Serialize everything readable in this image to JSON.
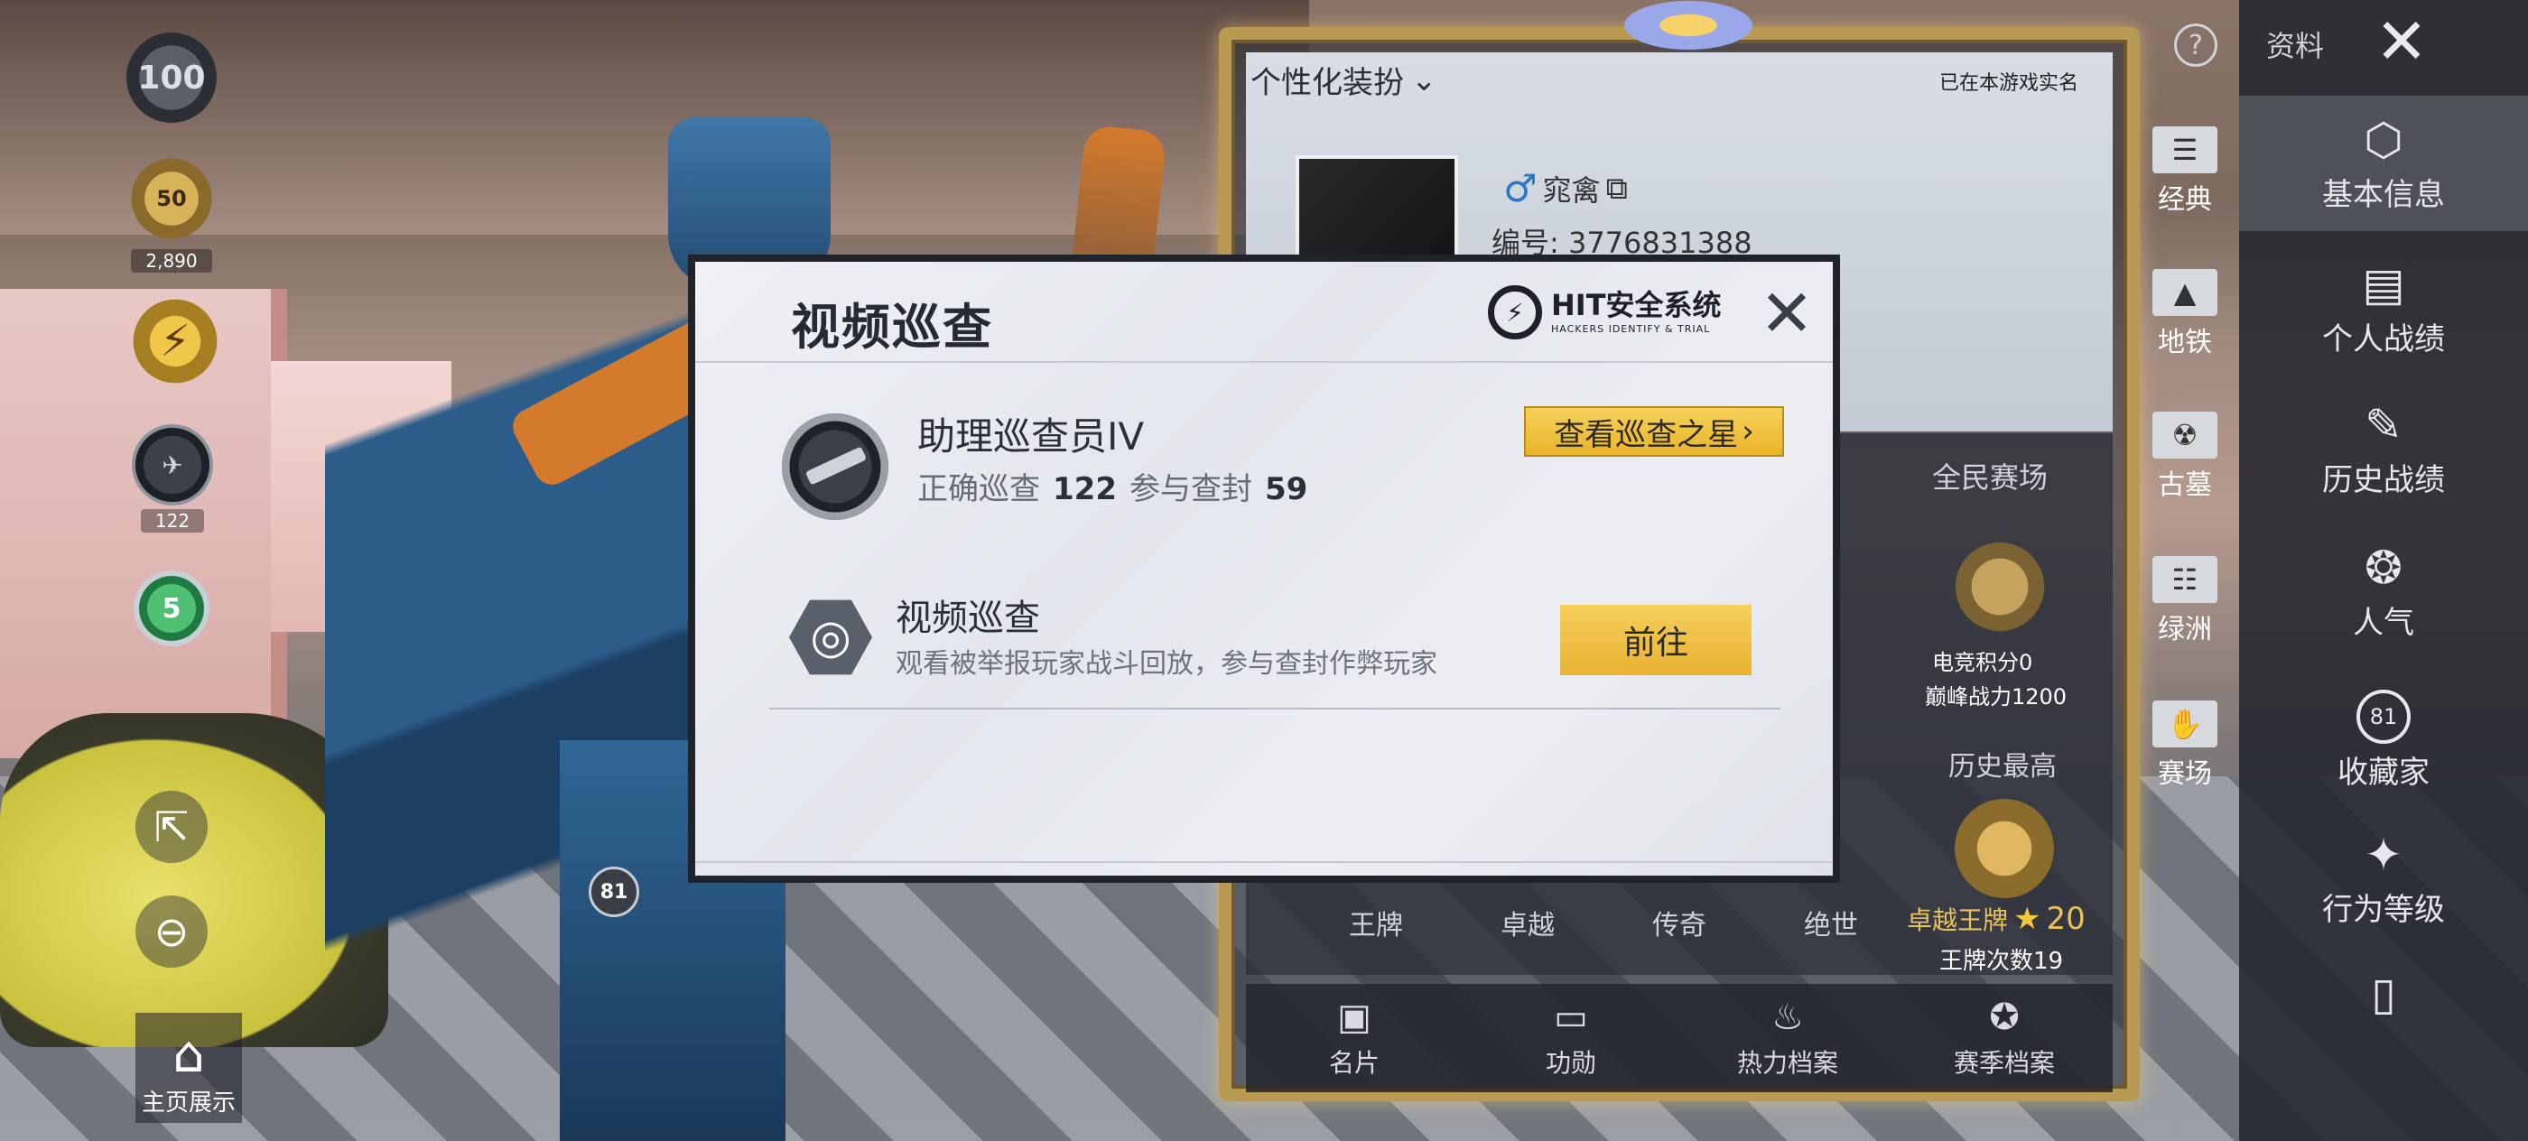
{
  "left": {
    "rank_badge_top": "100",
    "badge_level": "50",
    "badge_points": "2,890",
    "badge_count": "122",
    "emblem_label": "81",
    "homepage_label": "主页展示"
  },
  "profile": {
    "dressup_label": "个性化装扮",
    "verified_text": "已在本游戏实名",
    "player_name": "窕禽",
    "player_id": "编号: 3776831388",
    "arena_title": "全民赛场",
    "esports_score": "电竞积分0",
    "peak_power": "巅峰战力1200",
    "history_high": "历史最高",
    "tiers": [
      "王牌",
      "卓越",
      "传奇",
      "绝世"
    ],
    "current_tier": "卓越王牌",
    "current_tier_level": "20",
    "ace_count": "王牌次数19",
    "bottom_tabs": [
      {
        "label": "名片",
        "icon": "card-icon"
      },
      {
        "label": "功勋",
        "icon": "medal-icon"
      },
      {
        "label": "热力档案",
        "icon": "flame-icon"
      },
      {
        "label": "赛季档案",
        "icon": "season-icon"
      }
    ]
  },
  "modes": [
    {
      "label": "经典",
      "icon": "classic-icon"
    },
    {
      "label": "地铁",
      "icon": "metro-icon"
    },
    {
      "label": "古墓",
      "icon": "tomb-icon"
    },
    {
      "label": "绿洲",
      "icon": "oasis-icon"
    },
    {
      "label": "赛场",
      "icon": "arena-icon"
    }
  ],
  "topbar": {
    "help_icon": "?",
    "title": "资料",
    "close": "✕"
  },
  "nav": [
    {
      "label": "基本信息",
      "icon": "user-info-icon"
    },
    {
      "label": "个人战绩",
      "icon": "stats-icon"
    },
    {
      "label": "历史战绩",
      "icon": "history-icon"
    },
    {
      "label": "人气",
      "icon": "popularity-icon"
    },
    {
      "label": "收藏家",
      "icon": "collector-icon",
      "badge": "81"
    },
    {
      "label": "行为等级",
      "icon": "behavior-icon"
    }
  ],
  "dialog": {
    "title": "视频巡查",
    "logo_main": "HIT安全系统",
    "logo_sub": "HACKERS IDENTIFY & TRIAL",
    "close": "✕",
    "rank_title": "助理巡查员IV",
    "correct_label": "正确巡查",
    "correct_value": "122",
    "ban_label": "参与查封",
    "ban_value": "59",
    "star_button": "查看巡查之星",
    "patrol_title": "视频巡查",
    "patrol_desc": "观看被举报玩家战斗回放，参与查封作弊玩家",
    "go_button": "前往"
  }
}
